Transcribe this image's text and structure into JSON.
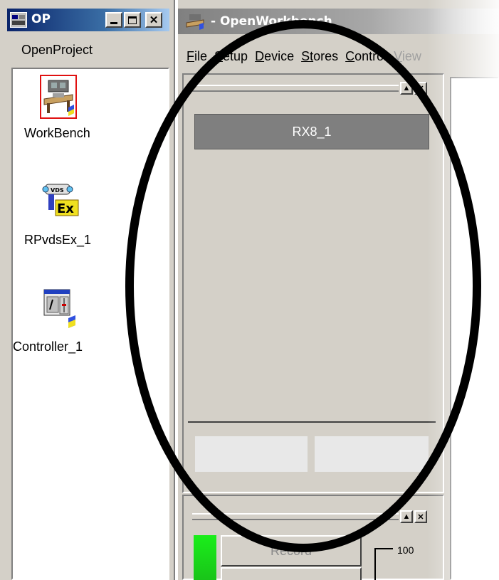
{
  "op_window": {
    "title": "OP",
    "project_label": "OpenProject",
    "items": [
      {
        "label": "WorkBench",
        "icon": "workbench-icon"
      },
      {
        "label": "RPvdsEx_1",
        "icon": "rpvdsex-icon"
      },
      {
        "label": "Controller_1",
        "icon": "controller-icon"
      }
    ]
  },
  "workbench_window": {
    "title": "- OpenWorkbench",
    "menu": {
      "file": {
        "u": "F",
        "rest": "ile"
      },
      "setup": {
        "u": "S",
        "rest": "etup"
      },
      "device": {
        "u": "D",
        "rest": "evice"
      },
      "stores": {
        "u": "St",
        "rest": "ores"
      },
      "control": {
        "u": "C",
        "rest": "ontrol"
      },
      "view": {
        "u": "V",
        "rest": "iew"
      }
    },
    "device_button": "RX8_1",
    "record_button": "Record",
    "meter_value": "100"
  },
  "colors": {
    "device_button_bg": "#7f7f7f",
    "meter_green": "#1aee1a",
    "annotation_oval": "#000000"
  }
}
